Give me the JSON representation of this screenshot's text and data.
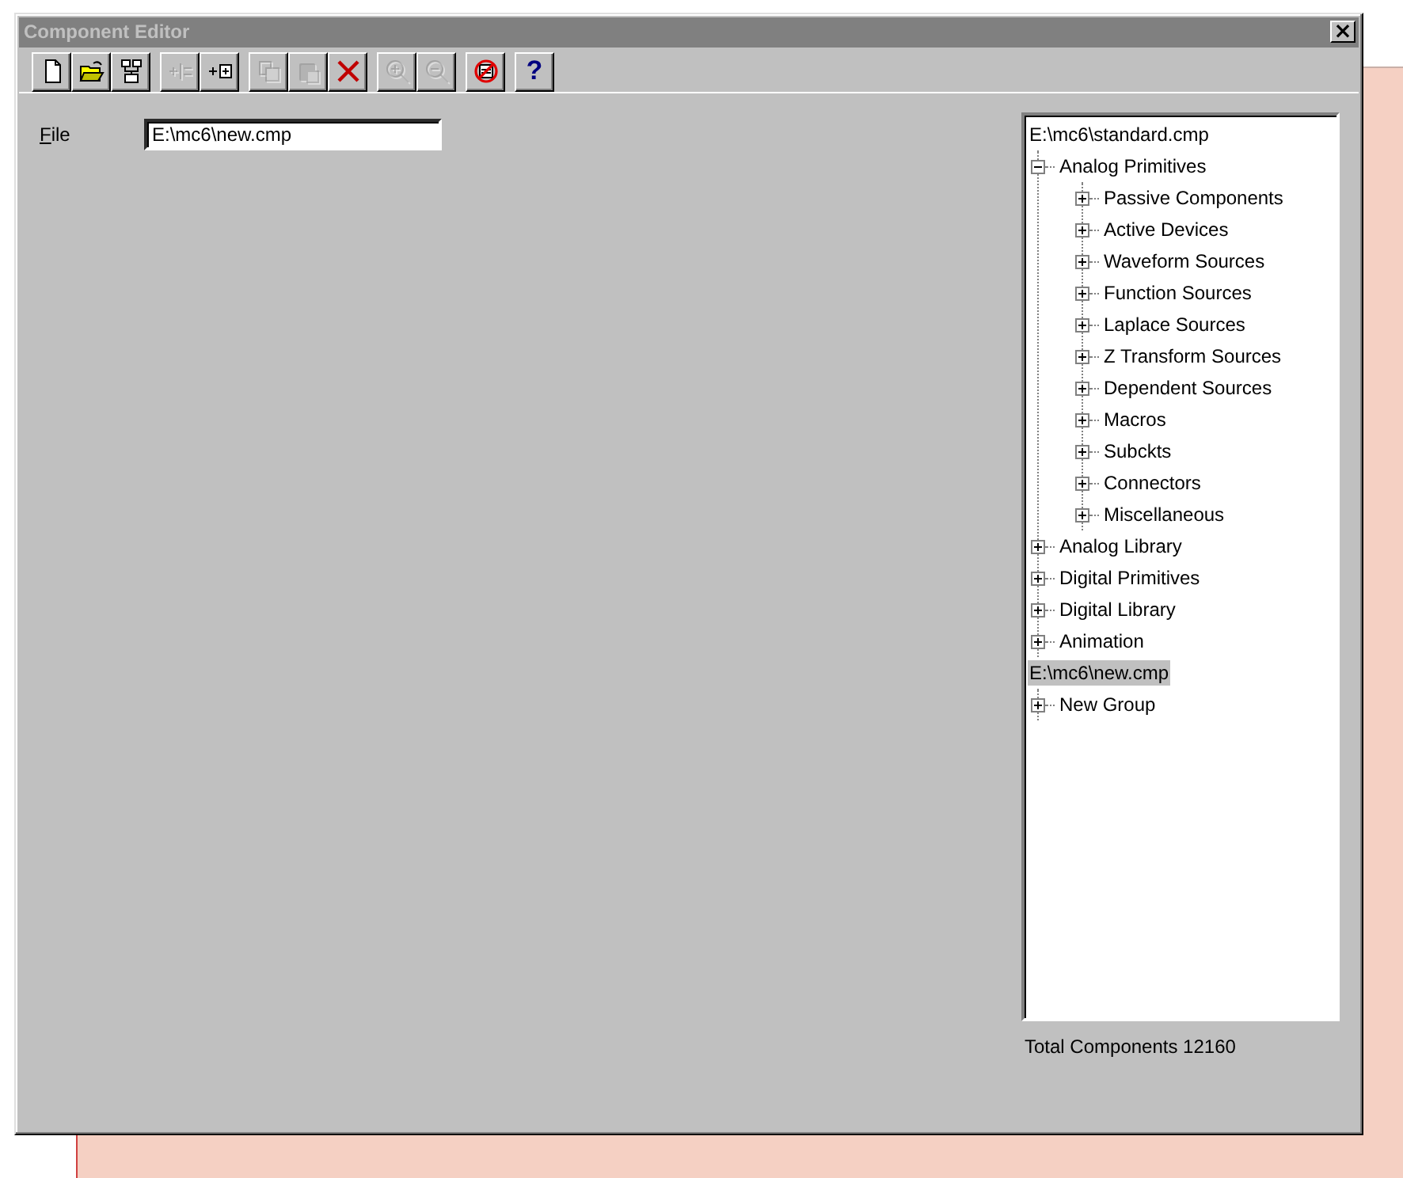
{
  "window": {
    "title": "Component Editor",
    "close": "×"
  },
  "toolbar": [
    {
      "kind": "new",
      "disabled": false
    },
    {
      "kind": "open",
      "disabled": false
    },
    {
      "kind": "structure",
      "disabled": false
    },
    {
      "kind": "add-split",
      "disabled": true
    },
    {
      "kind": "add-box",
      "disabled": false
    },
    {
      "kind": "copy",
      "disabled": true
    },
    {
      "kind": "paste",
      "disabled": true
    },
    {
      "kind": "delete",
      "disabled": false
    },
    {
      "kind": "zoom-in",
      "disabled": true
    },
    {
      "kind": "zoom-out",
      "disabled": true
    },
    {
      "kind": "no-entry",
      "disabled": false
    },
    {
      "kind": "help",
      "disabled": false,
      "label": "?"
    }
  ],
  "file": {
    "label": "File",
    "value": "E:\\mc6\\new.cmp"
  },
  "tree": [
    {
      "label": "E:\\mc6\\standard.cmp",
      "selected": false,
      "children": [
        {
          "label": "Analog Primitives",
          "selected": false,
          "expanded": true,
          "children": [
            {
              "label": "Passive Components",
              "selected": false,
              "expanded": false
            },
            {
              "label": "Active Devices",
              "selected": false,
              "expanded": false
            },
            {
              "label": "Waveform Sources",
              "selected": false,
              "expanded": false
            },
            {
              "label": "Function Sources",
              "selected": false,
              "expanded": false
            },
            {
              "label": "Laplace Sources",
              "selected": false,
              "expanded": false
            },
            {
              "label": "Z Transform Sources",
              "selected": false,
              "expanded": false
            },
            {
              "label": "Dependent Sources",
              "selected": false,
              "expanded": false
            },
            {
              "label": "Macros",
              "selected": false,
              "expanded": false
            },
            {
              "label": "Subckts",
              "selected": false,
              "expanded": false
            },
            {
              "label": "Connectors",
              "selected": false,
              "expanded": false
            },
            {
              "label": "Miscellaneous",
              "selected": false,
              "expanded": false
            }
          ]
        },
        {
          "label": "Analog Library",
          "selected": false,
          "expanded": false
        },
        {
          "label": "Digital Primitives",
          "selected": false,
          "expanded": false
        },
        {
          "label": "Digital Library",
          "selected": false,
          "expanded": false
        },
        {
          "label": "Animation",
          "selected": false,
          "expanded": false
        }
      ]
    },
    {
      "label": "E:\\mc6\\new.cmp",
      "selected": true,
      "children": [
        {
          "label": "New Group",
          "selected": false,
          "expanded": false
        }
      ]
    }
  ],
  "status": "Total Components 12160"
}
